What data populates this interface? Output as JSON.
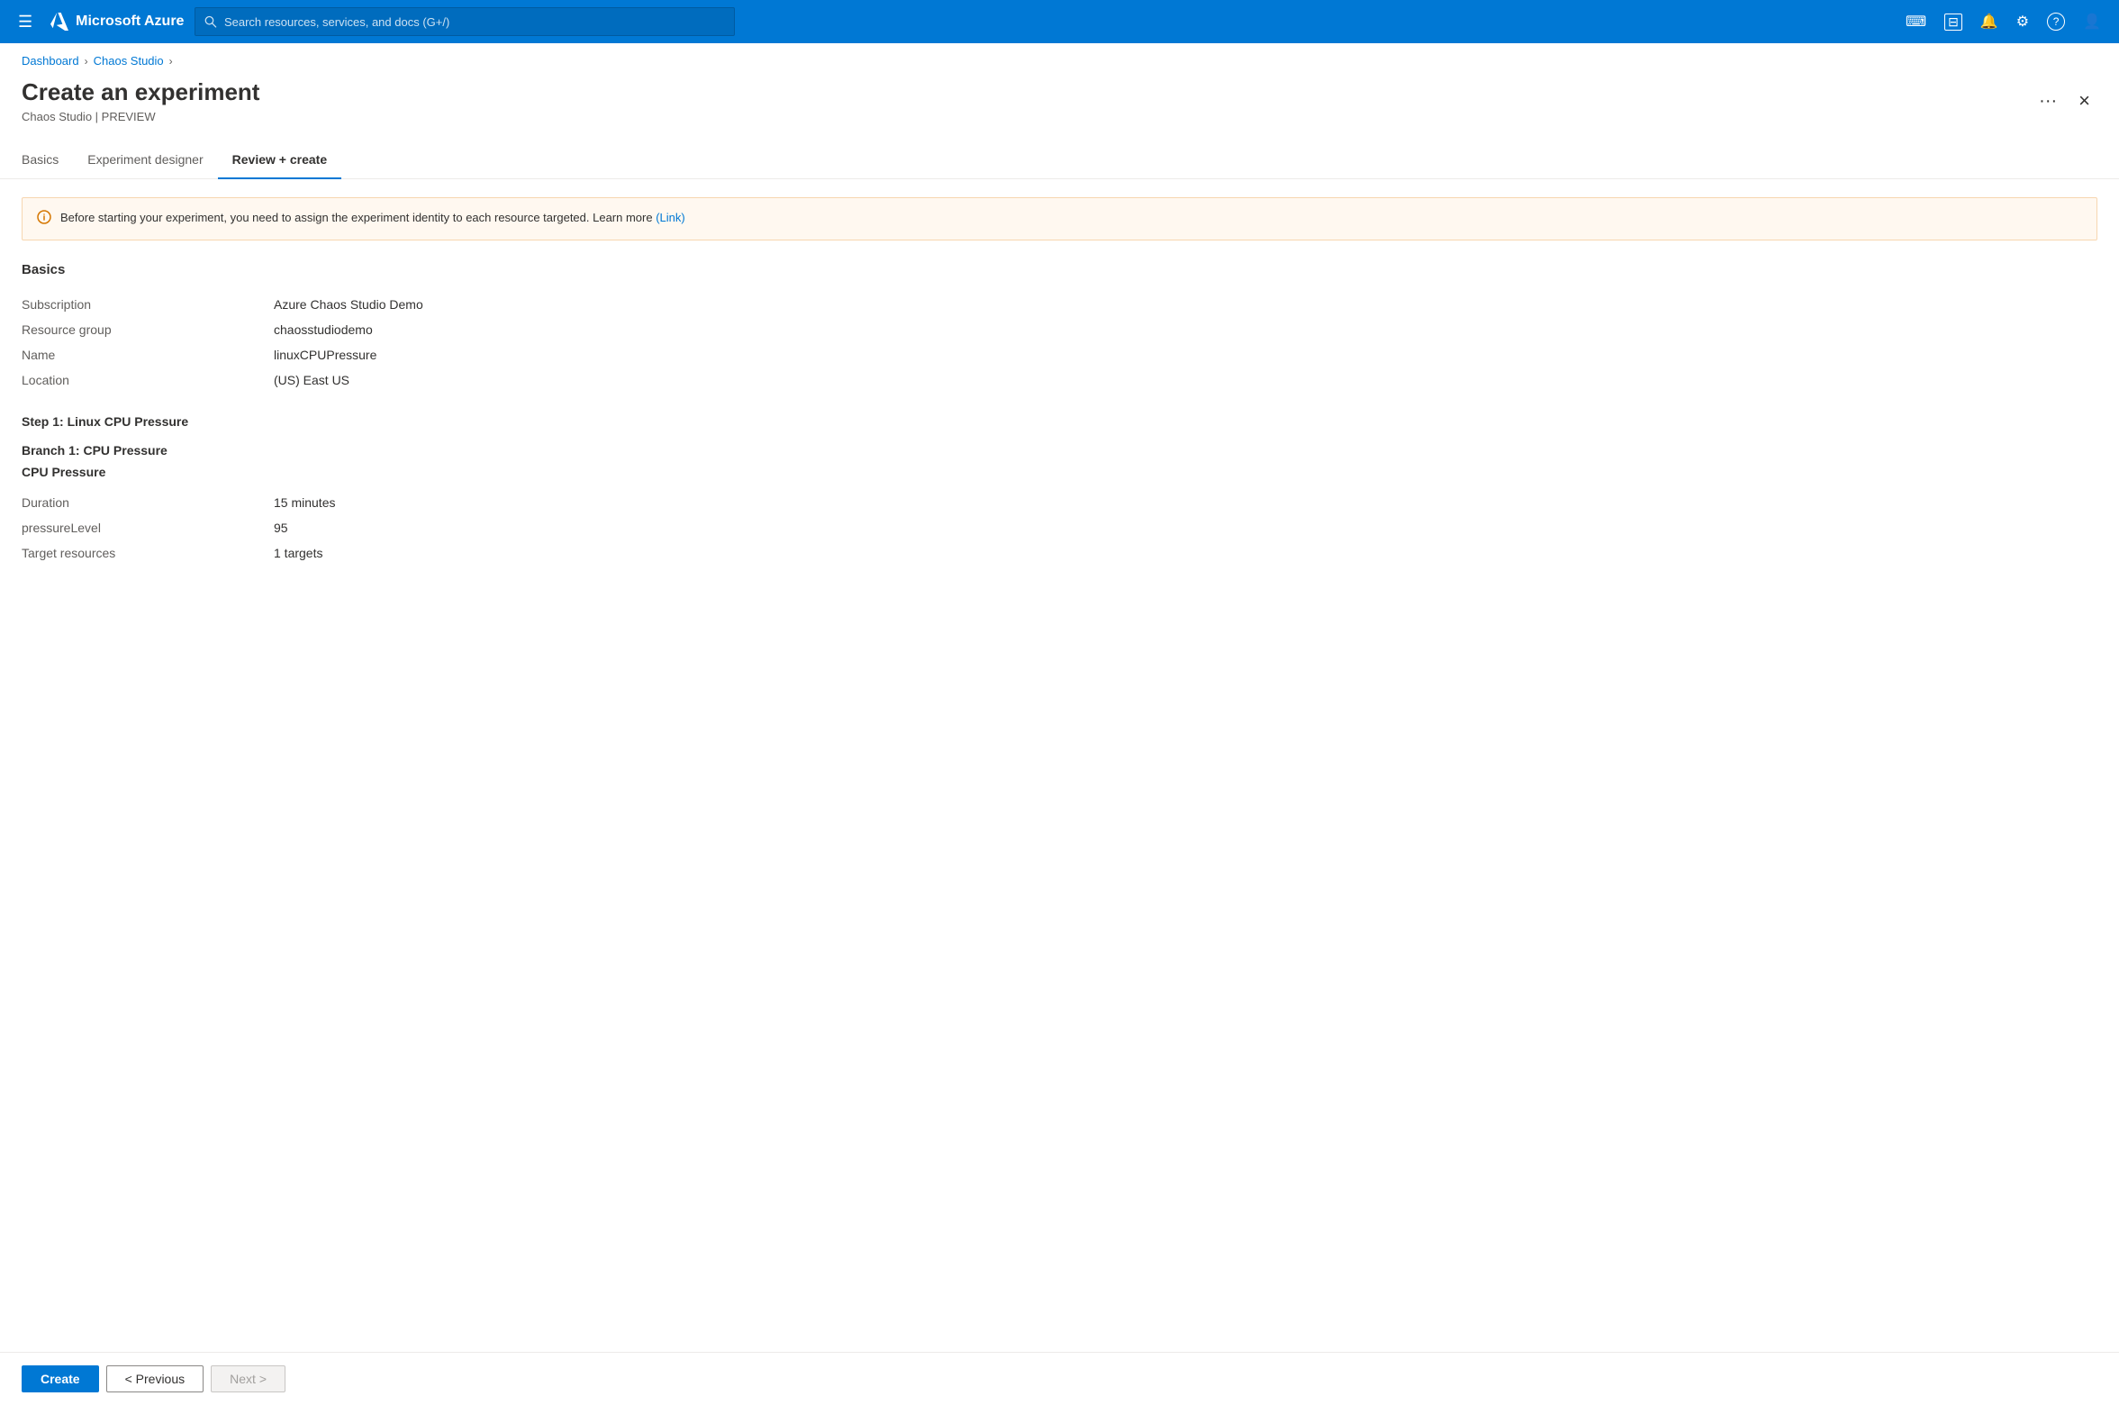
{
  "topbar": {
    "logo_text": "Microsoft Azure",
    "search_placeholder": "Search resources, services, and docs (G+/)",
    "hamburger_icon": "☰",
    "icons": [
      {
        "name": "terminal-icon",
        "symbol": "⌨",
        "label": "Cloud Shell"
      },
      {
        "name": "directory-icon",
        "symbol": "⊟",
        "label": "Directory"
      },
      {
        "name": "bell-icon",
        "symbol": "🔔",
        "label": "Notifications"
      },
      {
        "name": "settings-icon",
        "symbol": "⚙",
        "label": "Settings"
      },
      {
        "name": "help-icon",
        "symbol": "?",
        "label": "Help"
      },
      {
        "name": "account-icon",
        "symbol": "👤",
        "label": "Account"
      }
    ]
  },
  "breadcrumb": {
    "items": [
      {
        "label": "Dashboard",
        "href": "#"
      },
      {
        "label": "Chaos Studio",
        "href": "#"
      }
    ]
  },
  "page": {
    "title": "Create an experiment",
    "subtitle": "Chaos Studio | PREVIEW",
    "ellipsis_label": "···",
    "close_label": "×"
  },
  "tabs": [
    {
      "id": "basics",
      "label": "Basics",
      "active": false
    },
    {
      "id": "experiment-designer",
      "label": "Experiment designer",
      "active": false
    },
    {
      "id": "review-create",
      "label": "Review + create",
      "active": true
    }
  ],
  "info_banner": {
    "icon": "ℹ",
    "text": "Before starting your experiment, you need to assign the experiment identity to each resource targeted. Learn more",
    "link_label": "(Link)"
  },
  "basics_section": {
    "title": "Basics",
    "fields": [
      {
        "label": "Subscription",
        "value": "Azure Chaos Studio Demo"
      },
      {
        "label": "Resource group",
        "value": "chaosstudiodemo"
      },
      {
        "label": "Name",
        "value": "linuxCPUPressure"
      },
      {
        "label": "Location",
        "value": "(US) East US"
      }
    ]
  },
  "step_section": {
    "title": "Step 1: Linux CPU Pressure",
    "branch_title": "Branch 1: CPU Pressure",
    "fault_title": "CPU Pressure",
    "fields": [
      {
        "label": "Duration",
        "value": "15 minutes"
      },
      {
        "label": "pressureLevel",
        "value": "95"
      },
      {
        "label": "Target resources",
        "value": "1 targets"
      }
    ]
  },
  "footer": {
    "create_label": "Create",
    "previous_label": "< Previous",
    "next_label": "Next >"
  }
}
